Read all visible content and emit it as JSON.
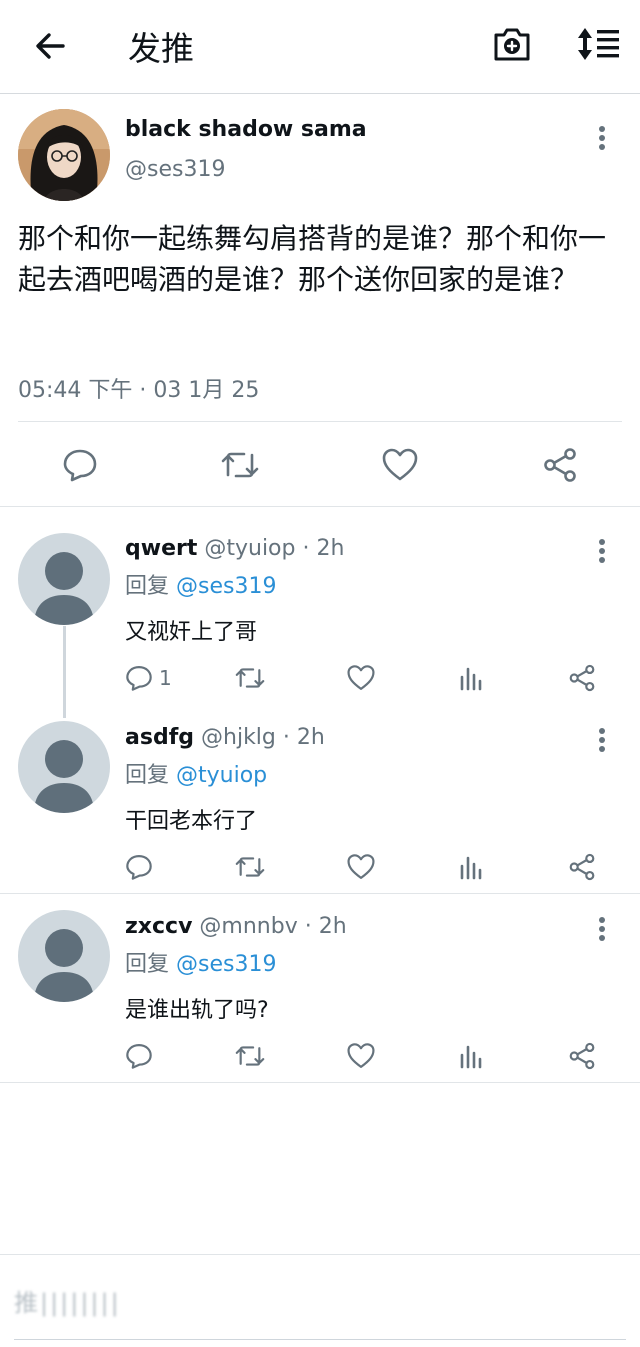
{
  "header": {
    "title": "发推",
    "back_icon": "arrow-left-icon",
    "camera_icon": "camera-plus-icon",
    "sort_icon": "sort-lines-icon"
  },
  "main_tweet": {
    "author_name": "black shadow sama",
    "author_handle": "@ses319",
    "text": "那个和你一起练舞勾肩搭背的是谁？那个和你一起去酒吧喝酒的是谁？那个送你回家的是谁？",
    "time": "05:44 下午 · 03 1月 25"
  },
  "replies": [
    {
      "name": "qwert",
      "handle": "@tyuiop",
      "age": "· 2h",
      "reply_prefix": "回复",
      "reply_to": "@ses319",
      "text": "又视奸上了哥",
      "reply_count": "1"
    },
    {
      "name": "asdfg",
      "handle": "@hjklg",
      "age": "· 2h",
      "reply_prefix": "回复",
      "reply_to": "@tyuiop",
      "text": "干回老本行了",
      "reply_count": ""
    },
    {
      "name": "zxccv",
      "handle": "@mnnbv",
      "age": "· 2h",
      "reply_prefix": "回复",
      "reply_to": "@ses319",
      "text": "是谁出轨了吗?",
      "reply_count": ""
    }
  ],
  "composer": {
    "placeholder": "推||||||||"
  },
  "colors": {
    "text": "#0f1419",
    "secondary": "#65727c",
    "mention": "#2a8fd6",
    "divider": "#e1e5e8",
    "avatar_bg": "#cfd8de",
    "avatar_fg": "#5f6f7b"
  }
}
